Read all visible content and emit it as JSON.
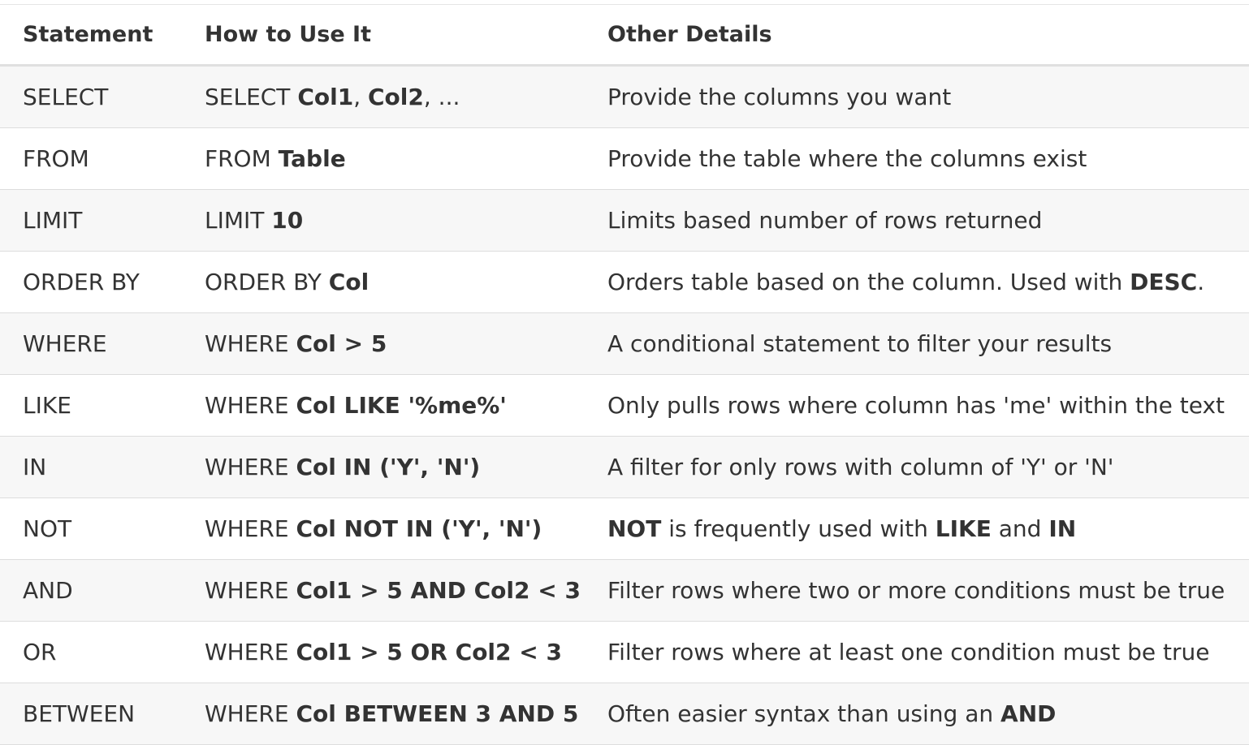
{
  "headers": [
    "Statement",
    "How to Use It",
    "Other Details"
  ],
  "rows": [
    {
      "statement": "SELECT",
      "usage": [
        {
          "t": "SELECT ",
          "b": false
        },
        {
          "t": "Col1",
          "b": true
        },
        {
          "t": ", ",
          "b": false
        },
        {
          "t": "Col2",
          "b": true
        },
        {
          "t": ", ...",
          "b": false
        }
      ],
      "details": [
        {
          "t": "Provide the columns you want",
          "b": false
        }
      ]
    },
    {
      "statement": "FROM",
      "usage": [
        {
          "t": "FROM ",
          "b": false
        },
        {
          "t": "Table",
          "b": true
        }
      ],
      "details": [
        {
          "t": "Provide the table where the columns exist",
          "b": false
        }
      ]
    },
    {
      "statement": "LIMIT",
      "usage": [
        {
          "t": "LIMIT ",
          "b": false
        },
        {
          "t": "10",
          "b": true
        }
      ],
      "details": [
        {
          "t": "Limits based number of rows returned",
          "b": false
        }
      ]
    },
    {
      "statement": "ORDER BY",
      "usage": [
        {
          "t": "ORDER BY ",
          "b": false
        },
        {
          "t": "Col",
          "b": true
        }
      ],
      "details": [
        {
          "t": "Orders table based on the column. Used with ",
          "b": false
        },
        {
          "t": "DESC",
          "b": true
        },
        {
          "t": ".",
          "b": false
        }
      ]
    },
    {
      "statement": "WHERE",
      "usage": [
        {
          "t": "WHERE ",
          "b": false
        },
        {
          "t": "Col > 5",
          "b": true
        }
      ],
      "details": [
        {
          "t": "A conditional statement to filter your results",
          "b": false
        }
      ]
    },
    {
      "statement": "LIKE",
      "usage": [
        {
          "t": "WHERE ",
          "b": false
        },
        {
          "t": "Col LIKE '%me%'",
          "b": true
        }
      ],
      "details": [
        {
          "t": "Only pulls rows where column has 'me' within the text",
          "b": false
        }
      ]
    },
    {
      "statement": "IN",
      "usage": [
        {
          "t": "WHERE ",
          "b": false
        },
        {
          "t": "Col IN ('Y', 'N')",
          "b": true
        }
      ],
      "details": [
        {
          "t": "A filter for only rows with column of 'Y' or 'N'",
          "b": false
        }
      ]
    },
    {
      "statement": "NOT",
      "usage": [
        {
          "t": "WHERE ",
          "b": false
        },
        {
          "t": "Col NOT IN ('Y', 'N')",
          "b": true
        }
      ],
      "details": [
        {
          "t": "NOT",
          "b": true
        },
        {
          "t": " is frequently used with ",
          "b": false
        },
        {
          "t": "LIKE",
          "b": true
        },
        {
          "t": " and ",
          "b": false
        },
        {
          "t": "IN",
          "b": true
        }
      ]
    },
    {
      "statement": "AND",
      "usage": [
        {
          "t": "WHERE ",
          "b": false
        },
        {
          "t": "Col1 > 5 AND Col2 < 3",
          "b": true
        }
      ],
      "details": [
        {
          "t": "Filter rows where two or more conditions must be true",
          "b": false
        }
      ]
    },
    {
      "statement": "OR",
      "usage": [
        {
          "t": "WHERE ",
          "b": false
        },
        {
          "t": "Col1 > 5 OR Col2 < 3",
          "b": true
        }
      ],
      "details": [
        {
          "t": "Filter rows where at least one condition must be true",
          "b": false
        }
      ]
    },
    {
      "statement": "BETWEEN",
      "usage": [
        {
          "t": "WHERE ",
          "b": false
        },
        {
          "t": "Col BETWEEN 3 AND 5",
          "b": true
        }
      ],
      "details": [
        {
          "t": "Often easier syntax than using an ",
          "b": false
        },
        {
          "t": "AND",
          "b": true
        }
      ]
    }
  ]
}
